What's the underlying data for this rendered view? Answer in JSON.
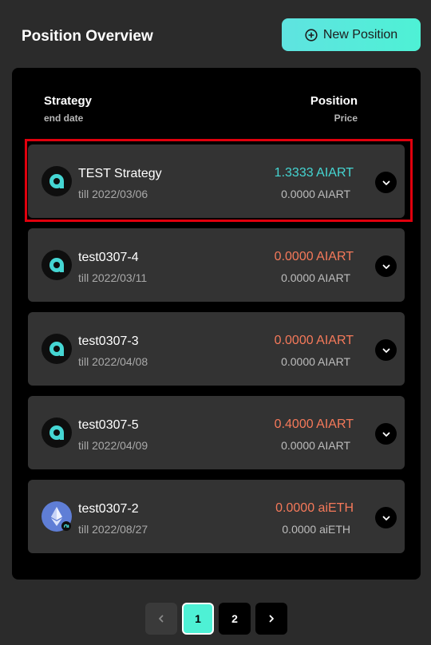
{
  "header": {
    "title": "Position Overview",
    "new_position_label": "New Position"
  },
  "table": {
    "col_left_main": "Strategy",
    "col_left_sub": "end date",
    "col_right_main": "Position",
    "col_right_sub": "Price"
  },
  "positions": [
    {
      "name": "TEST Strategy",
      "date": "till 2022/03/06",
      "position": "1.3333 AIART",
      "price": "0.0000 AIART",
      "position_color": "#45d6d3",
      "icon": "aiart-logo-icon"
    },
    {
      "name": "test0307-4",
      "date": "till 2022/03/11",
      "position": "0.0000 AIART",
      "price": "0.0000 AIART",
      "position_color": "#f5795a",
      "icon": "aiart-logo-icon"
    },
    {
      "name": "test0307-3",
      "date": "till 2022/04/08",
      "position": "0.0000 AIART",
      "price": "0.0000 AIART",
      "position_color": "#f5795a",
      "icon": "aiart-logo-icon"
    },
    {
      "name": "test0307-5",
      "date": "till 2022/04/09",
      "position": "0.4000 AIART",
      "price": "0.0000 AIART",
      "position_color": "#f5795a",
      "icon": "aiart-logo-icon"
    },
    {
      "name": "test0307-2",
      "date": "till 2022/08/27",
      "position": "0.0000 aiETH",
      "price": "0.0000 aiETH",
      "position_color": "#f5795a",
      "icon": "aieth-logo-icon"
    }
  ],
  "pagination": {
    "pages": [
      "1",
      "2"
    ],
    "current": "1"
  },
  "colors": {
    "accent": "#4ef1d5",
    "positive": "#45d6d3",
    "negative": "#f5795a",
    "highlight": "#e0000d"
  }
}
